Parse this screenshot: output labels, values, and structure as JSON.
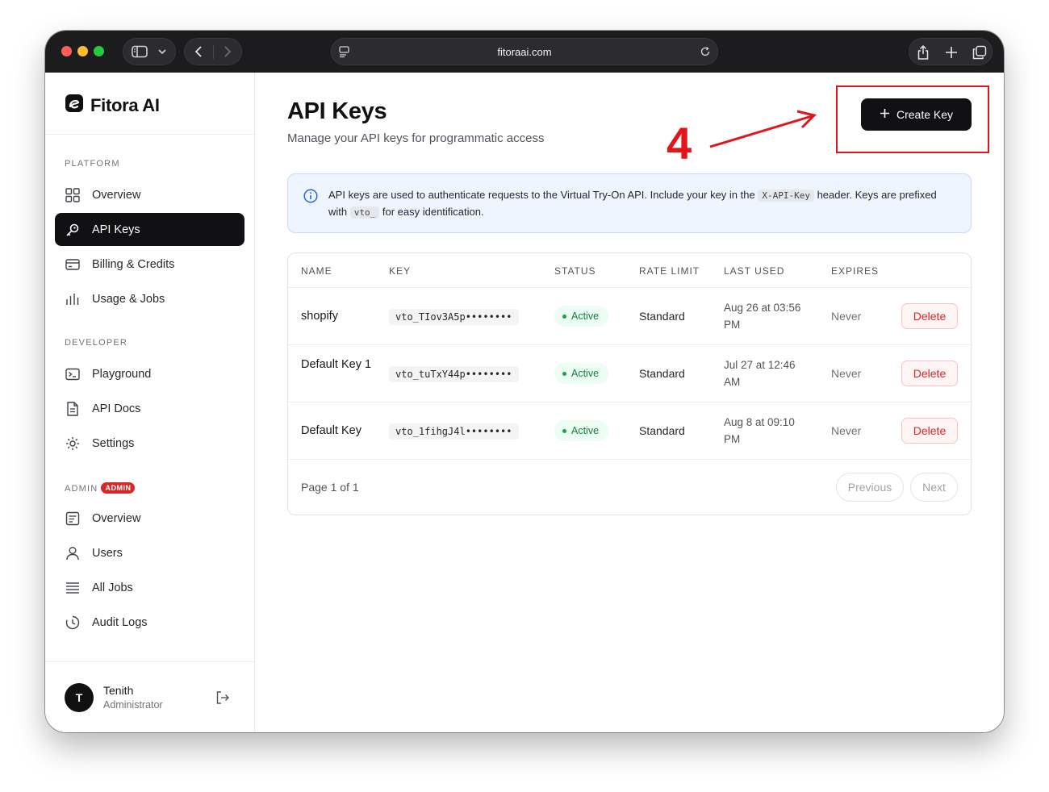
{
  "browser": {
    "url": "fitoraai.com"
  },
  "sidebar": {
    "brand": "Fitora AI",
    "sections": [
      {
        "label": "PLATFORM",
        "items": [
          {
            "label": "Overview",
            "icon": "grid-icon"
          },
          {
            "label": "API Keys",
            "icon": "key-icon",
            "active": true
          },
          {
            "label": "Billing & Credits",
            "icon": "credit-card-icon"
          },
          {
            "label": "Usage & Jobs",
            "icon": "bar-chart-icon"
          }
        ]
      },
      {
        "label": "DEVELOPER",
        "items": [
          {
            "label": "Playground",
            "icon": "terminal-icon"
          },
          {
            "label": "API Docs",
            "icon": "document-icon"
          },
          {
            "label": "Settings",
            "icon": "gear-icon"
          }
        ]
      },
      {
        "label": "ADMIN",
        "badge": "ADMIN",
        "items": [
          {
            "label": "Overview",
            "icon": "admin-overview-icon"
          },
          {
            "label": "Users",
            "icon": "user-icon"
          },
          {
            "label": "All Jobs",
            "icon": "list-icon"
          },
          {
            "label": "Audit Logs",
            "icon": "history-icon"
          }
        ]
      }
    ],
    "user": {
      "initial": "T",
      "name": "Tenith",
      "role": "Administrator"
    }
  },
  "main": {
    "title": "API Keys",
    "subtitle": "Manage your API keys for programmatic access",
    "create_button": "Create Key",
    "annotation_step": "4",
    "info": {
      "part1": "API keys are used to authenticate requests to the Virtual Try-On API. Include your key in the",
      "code1": "X-API-Key",
      "part2": "header. Keys are prefixed with",
      "code2": "vto_",
      "part3": "for easy identification."
    },
    "table": {
      "columns": [
        "NAME",
        "KEY",
        "STATUS",
        "RATE LIMIT",
        "LAST USED",
        "EXPIRES"
      ],
      "rows": [
        {
          "name": "shopify",
          "key": "vto_TIov3A5p••••••••",
          "status": "Active",
          "rate_limit": "Standard",
          "last_used": "Aug 26 at 03:56 PM",
          "expires": "Never",
          "action": "Delete"
        },
        {
          "name": "Default Key 1",
          "key": "vto_tuTxY44p••••••••",
          "status": "Active",
          "rate_limit": "Standard",
          "last_used": "Jul 27 at 12:46 AM",
          "expires": "Never",
          "action": "Delete"
        },
        {
          "name": "Default Key",
          "key": "vto_1fihgJ4l••••••••",
          "status": "Active",
          "rate_limit": "Standard",
          "last_used": "Aug 8 at 09:10 PM",
          "expires": "Never",
          "action": "Delete"
        }
      ],
      "page_info": "Page 1 of 1",
      "prev_label": "Previous",
      "next_label": "Next"
    }
  },
  "colors": {
    "accent": "#111113",
    "annotation": "#e3151a",
    "active_status": "#15803d",
    "danger": "#dc2626",
    "info_bg": "#eef5ff"
  }
}
